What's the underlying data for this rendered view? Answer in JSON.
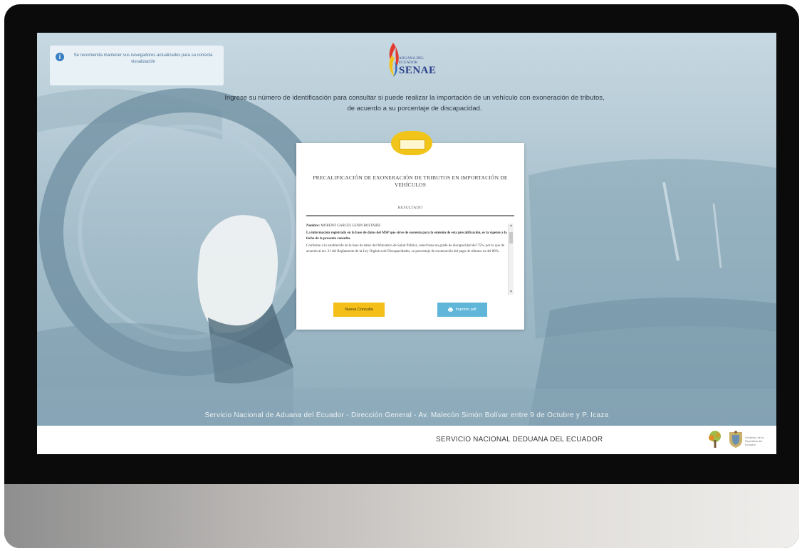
{
  "notice": {
    "text": "Se recomienda mantener sus navegadores actualizados para su correcta visualización"
  },
  "logo": {
    "line1": "ADUANA DEL",
    "line2": "ECUADOR",
    "name": "SENAE"
  },
  "intro": {
    "text": "Ingrese su número de identificación para consultar si puede realizar la importación de un vehículo con exoneración de tributos, de acuerdo a su porcentaje de discapacidad."
  },
  "card": {
    "title": "PRECALIFICACIÓN DE EXONERACIÓN DE TRIBUTOS EN IMPORTACIÓN DE VEHÍCULOS",
    "subtitle": "RESULTADO",
    "name_label": "Nombre:",
    "name_value": "MORENO GARCES LENIN BOLTAIRE",
    "paragraph1": "La información registrada en la base de datos del MSP que sirve de sustento para la emisión de esta precalificación, es la vigente a la fecha de la presente consulta.",
    "paragraph2": "Conforme a lo establecido en la base de datos del Ministerio de Salud Pública, usted tiene un grado de discapacidad del 75%, por lo que de acuerdo al art. 21 del Reglamento de la Ley Orgánica de Discapacidades, su porcentaje de exoneración del pago de tributos es del 80%.",
    "new_query_label": "Nueva Consulta",
    "print_label": "Imprimir pdf"
  },
  "address": {
    "text": "Servicio Nacional de Aduana del Ecuador - Dirección General - Av. Malecón Simón Bolívar entre 9 de Octubre y P. Icaza"
  },
  "footer": {
    "text": "SERVICIO NACIONAL DEDUANA DEL ECUADOR",
    "mini": "Gobierno de la República del Ecuador"
  },
  "colors": {
    "accent_yellow": "#f3bf18",
    "accent_blue": "#5fb6d8",
    "bezel": "#0b0b0b"
  }
}
